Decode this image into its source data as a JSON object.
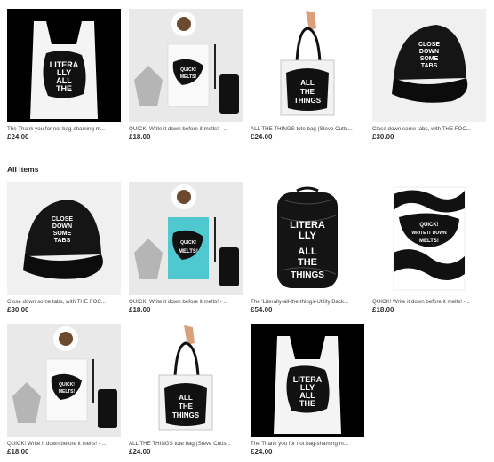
{
  "featured": [
    {
      "title": "The Thank you for not bag-shaming m...",
      "price": "£24.00",
      "image": "bag-black-background"
    },
    {
      "title": "QUICK! Write it down before it melts! - ...",
      "price": "£18.00",
      "image": "notebook-white-flatlay"
    },
    {
      "title": "ALL THE THINGS tote bag (Steve Cutts...",
      "price": "£24.00",
      "image": "clear-tote-bag"
    },
    {
      "title": "Close down some tabs, with THE FOC...",
      "price": "£30.00",
      "image": "black-cap"
    }
  ],
  "all_items_heading": "All items",
  "all_items": [
    {
      "title": "Close down some tabs, with THE FOC...",
      "price": "£30.00",
      "image": "black-cap"
    },
    {
      "title": "QUICK! Write it down before it melts! - ...",
      "price": "£18.00",
      "image": "notebook-teal-flatlay"
    },
    {
      "title": "The 'Literally-all-the-things-Utility Back...",
      "price": "£54.00",
      "image": "black-backpack"
    },
    {
      "title": "QUICK! Write it down before it melts! -...",
      "price": "£18.00",
      "image": "notebook-zebra"
    },
    {
      "title": "QUICK! Write it down before it melts! - ...",
      "price": "£18.00",
      "image": "notebook-white-flatlay"
    },
    {
      "title": "ALL THE THINGS tote bag (Steve Cutts...",
      "price": "£24.00",
      "image": "clear-tote-bag"
    },
    {
      "title": "The Thank you for not bag-shaming m...",
      "price": "£24.00",
      "image": "bag-black-background"
    }
  ],
  "artwork_text": {
    "literally": "LITERA LLY ALL THE THINGS",
    "tabs": "CLOSE DOWN SOME TABS",
    "quick": "QUICK! WRITE IT DOWN BEFORE IT MELTS!"
  }
}
